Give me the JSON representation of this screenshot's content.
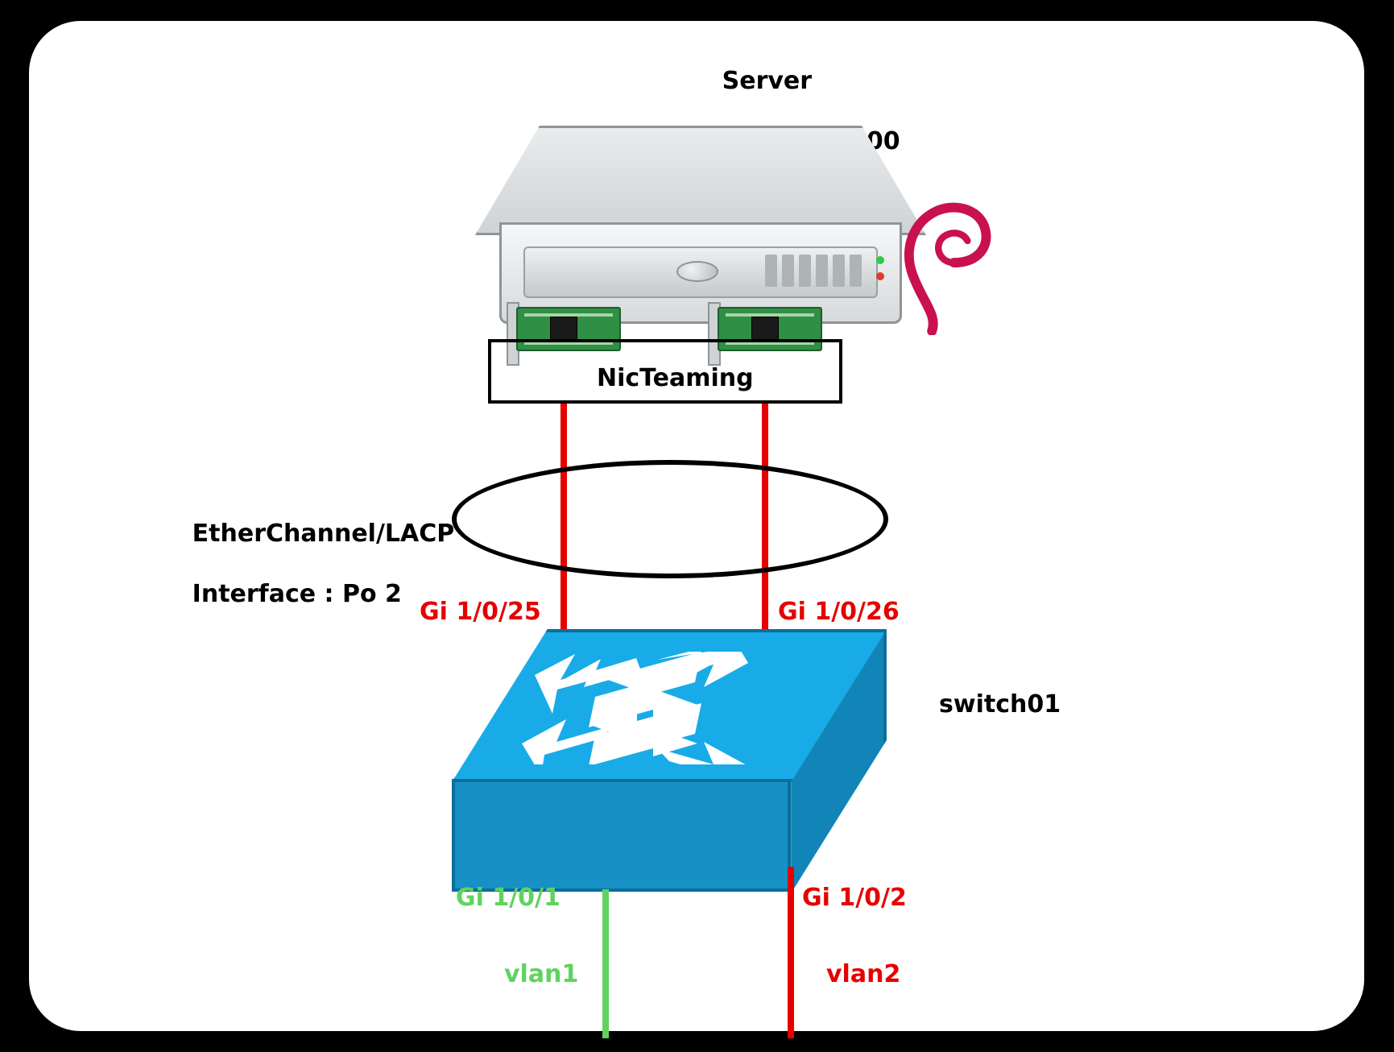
{
  "server": {
    "title": "Server",
    "ip_label": "IP : 192.168.1.200",
    "os_icon": "debian-swirl-icon"
  },
  "nic_teaming": {
    "label": "NicTeaming"
  },
  "etherchannel": {
    "line1": "EtherChannel/LACP",
    "line2": "Interface : Po 2"
  },
  "uplinks": {
    "left": {
      "label": "Gi 1/0/25"
    },
    "right": {
      "label": "Gi 1/0/26"
    }
  },
  "switch": {
    "name": "switch01"
  },
  "downlinks": {
    "left": {
      "port": "Gi 1/0/1",
      "vlan": "vlan1",
      "color": "green"
    },
    "right": {
      "port": "Gi 1/0/2",
      "vlan": "vlan2",
      "color": "red"
    }
  }
}
